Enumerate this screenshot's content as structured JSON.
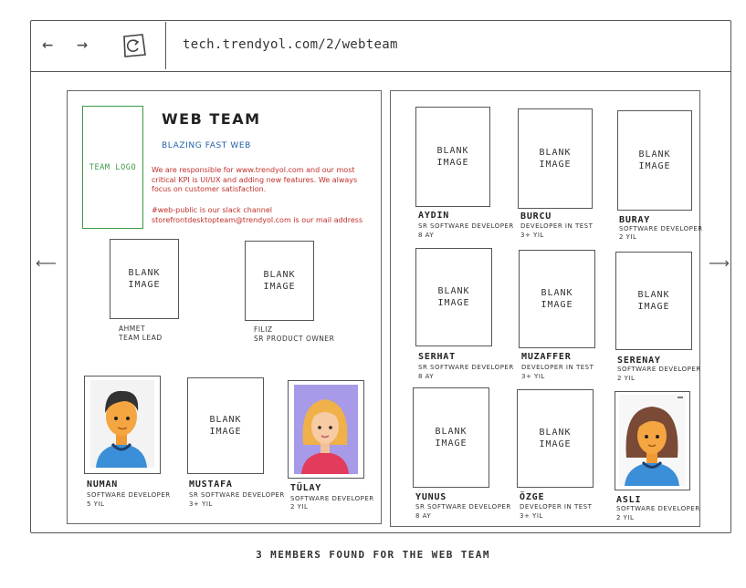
{
  "browser": {
    "url": "tech.trendyol.com/2/webteam"
  },
  "team": {
    "title": "WEB TEAM",
    "subtitle": "BLAZING FAST WEB",
    "logo_label": "TEAM LOGO",
    "desc1": "We are responsible for www.trendyol.com and our most critical KPI is UI/UX and adding new features. We always focus on customer satisfaction.",
    "desc2": "#web-public is our slack channel",
    "desc3": "storefrontdesktopteam@trendyol.com is our mail address"
  },
  "blank_label": "BLANK\nIMAGE",
  "leaders": [
    {
      "name": "AHMET",
      "role": "TEAM LEAD"
    },
    {
      "name": "FILIZ",
      "role": "SR PRODUCT OWNER"
    }
  ],
  "left_members": [
    {
      "name": "NUMAN",
      "role": "SOFTWARE DEVELOPER",
      "tenure": "5 YIL"
    },
    {
      "name": "MUSTAFA",
      "role": "SR SOFTWARE DEVELOPER",
      "tenure": "3+ YIL"
    },
    {
      "name": "TÜLAY",
      "role": "SOFTWARE DEVELOPER",
      "tenure": "2 YIL"
    }
  ],
  "right_members": [
    {
      "name": "AYDIN",
      "role": "SR SOFTWARE DEVELOPER",
      "tenure": "8 AY"
    },
    {
      "name": "BURCU",
      "role": "DEVELOPER IN TEST",
      "tenure": "3+ YIL"
    },
    {
      "name": "BURAY",
      "role": "SOFTWARE DEVELOPER",
      "tenure": "2 YIL"
    },
    {
      "name": "SERHAT",
      "role": "SR SOFTWARE DEVELOPER",
      "tenure": "8 AY"
    },
    {
      "name": "MUZAFFER",
      "role": "DEVELOPER IN TEST",
      "tenure": "3+ YIL"
    },
    {
      "name": "SERENAY",
      "role": "SOFTWARE DEVELOPER",
      "tenure": "2 YIL"
    },
    {
      "name": "YUNUS",
      "role": "SR SOFTWARE DEVELOPER",
      "tenure": "8 AY"
    },
    {
      "name": "ÖZGE",
      "role": "DEVELOPER IN TEST",
      "tenure": "3+ YIL"
    },
    {
      "name": "ASLI",
      "role": "SOFTWARE DEVELOPER",
      "tenure": "2 YIL"
    }
  ],
  "footer": "3 MEMBERS FOUND FOR THE WEB TEAM",
  "colors": {
    "accent_blue": "#1f5fa8",
    "desc_red": "#c0302a",
    "logo_green": "#3c9a45"
  }
}
